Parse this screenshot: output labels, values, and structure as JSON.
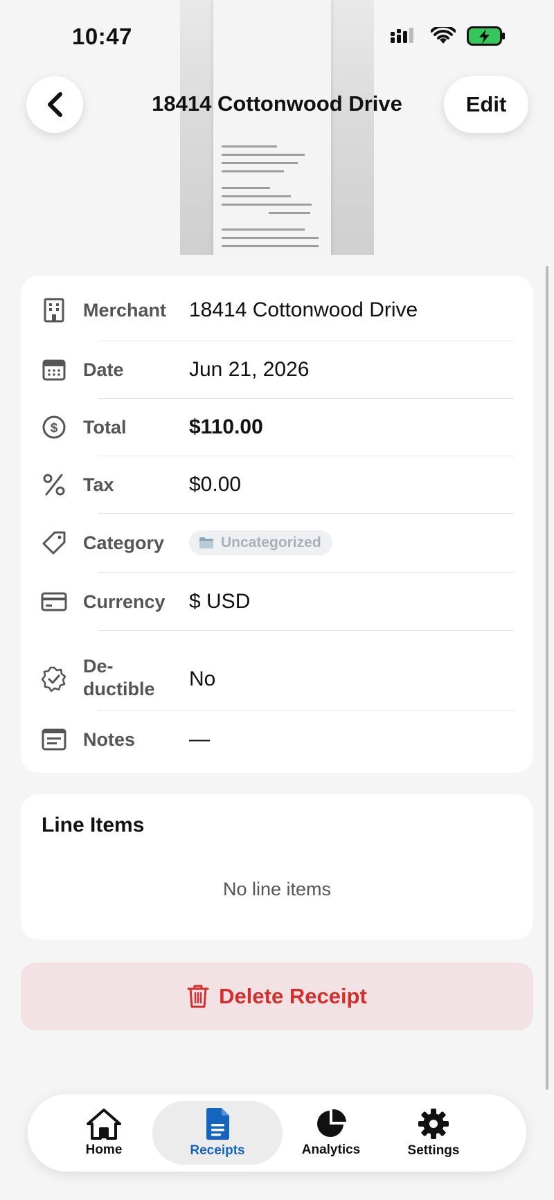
{
  "status_bar": {
    "time": "10:47"
  },
  "header": {
    "title": "18414 Cottonwood Drive",
    "edit_label": "Edit"
  },
  "details": {
    "merchant": {
      "label": "Merchant",
      "value": "18414 Cottonwood Drive"
    },
    "date": {
      "label": "Date",
      "value": "Jun 21, 2026"
    },
    "total": {
      "label": "Total",
      "value": "$110.00"
    },
    "tax": {
      "label": "Tax",
      "value": "$0.00"
    },
    "category": {
      "label": "Category",
      "value": "Uncategorized"
    },
    "currency": {
      "label": "Currency",
      "value": "$ USD"
    },
    "deductible": {
      "label_line1": "De-",
      "label_line2": "ductible",
      "value": "No"
    },
    "notes": {
      "label": "Notes",
      "value": "—"
    }
  },
  "line_items": {
    "title": "Line Items",
    "empty_text": "No line items"
  },
  "delete": {
    "label": "Delete Receipt"
  },
  "tabs": [
    {
      "label": "Home"
    },
    {
      "label": "Receipts"
    },
    {
      "label": "Analytics"
    },
    {
      "label": "Settings"
    }
  ],
  "colors": {
    "accent": "#1565c0",
    "danger": "#d32f2f",
    "battery": "#34c759"
  }
}
